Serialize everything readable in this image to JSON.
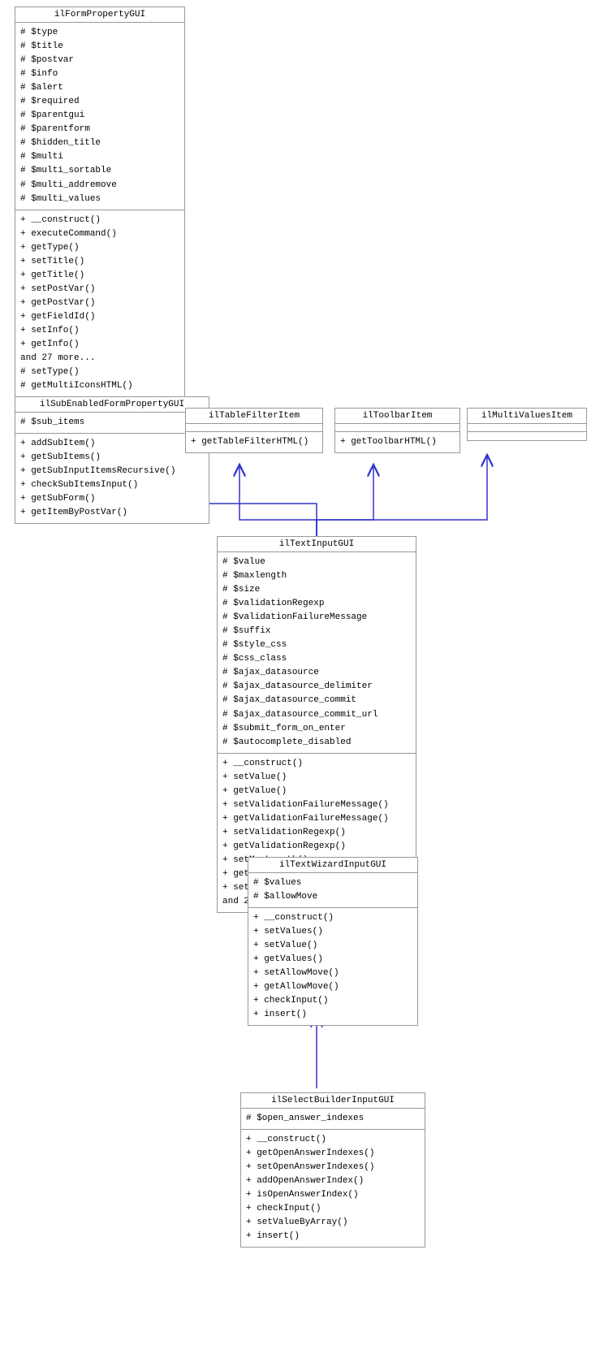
{
  "boxes": {
    "ilFormPropertyGUI": {
      "title": "ilFormPropertyGUI",
      "fields": [
        "# $type",
        "# $title",
        "# $postvar",
        "# $info",
        "# $alert",
        "# $required",
        "# $parentgui",
        "# $parentform",
        "# $hidden_title",
        "# $multi",
        "# $multi_sortable",
        "# $multi_addremove",
        "# $multi_values"
      ],
      "methods": [
        "+ __construct()",
        "+ executeCommand()",
        "+ getType()",
        "+ setTitle()",
        "+ getTitle()",
        "+ setPostVar()",
        "+ getPostVar()",
        "+ getFieldId()",
        "+ setInfo()",
        "+ getInfo()",
        "and 27 more...",
        "# setType()",
        "# getMultiIconsHTML()"
      ]
    },
    "ilSubEnabledFormPropertyGUI": {
      "title": "ilSubEnabledFormPropertyGUI",
      "fields": [
        "# $sub_items"
      ],
      "methods": [
        "+ addSubItem()",
        "+ getSubItems()",
        "+ getSubInputItemsRecursive()",
        "+ checkSubItemsInput()",
        "+ getSubForm()",
        "+ getItemByPostVar()"
      ]
    },
    "ilTableFilterItem": {
      "title": "ilTableFilterItem",
      "fields": [],
      "methods": [
        "+ getTableFilterHTML()"
      ]
    },
    "ilToolbarItem": {
      "title": "ilToolbarItem",
      "fields": [],
      "methods": [
        "+ getToolbarHTML()"
      ]
    },
    "ilMultiValuesItem": {
      "title": "ilMultiValuesItem",
      "fields": [],
      "methods": []
    },
    "ilTextInputGUI": {
      "title": "ilTextInputGUI",
      "fields": [
        "# $value",
        "# $maxlength",
        "# $size",
        "# $validationRegexp",
        "# $validationFailureMessage",
        "# $suffix",
        "# $style_css",
        "# $css_class",
        "# $ajax_datasource",
        "# $ajax_datasource_delimiter",
        "# $ajax_datasource_commit",
        "# $ajax_datasource_commit_url",
        "# $submit_form_on_enter",
        "# $autocomplete_disabled"
      ],
      "methods": [
        "+ __construct()",
        "+ setValue()",
        "+ getValue()",
        "+ setValidationFailureMessage()",
        "+ getValidationFailureMessage()",
        "+ setValidationRegexp()",
        "+ getValidationRegexp()",
        "+ setMaxLength()",
        "+ getMaxLength()",
        "+ setSize()",
        "and 25 more..."
      ]
    },
    "ilTextWizardInputGUI": {
      "title": "ilTextWizardInputGUI",
      "fields": [
        "# $values",
        "# $allowMove"
      ],
      "methods": [
        "+ __construct()",
        "+ setValues()",
        "+ setValue()",
        "+ getValues()",
        "+ setAllowMove()",
        "+ getAllowMove()",
        "+ checkInput()",
        "+ insert()"
      ]
    },
    "ilSelectBuilderInputGUI": {
      "title": "ilSelectBuilderInputGUI",
      "fields": [
        "# $open_answer_indexes"
      ],
      "methods": [
        "+ __construct()",
        "+ getOpenAnswerIndexes()",
        "+ setOpenAnswerIndexes()",
        "+ addOpenAnswerIndex()",
        "+ isOpenAnswerIndex()",
        "+ checkInput()",
        "+ setValueByArray()",
        "+ insert()"
      ]
    }
  }
}
